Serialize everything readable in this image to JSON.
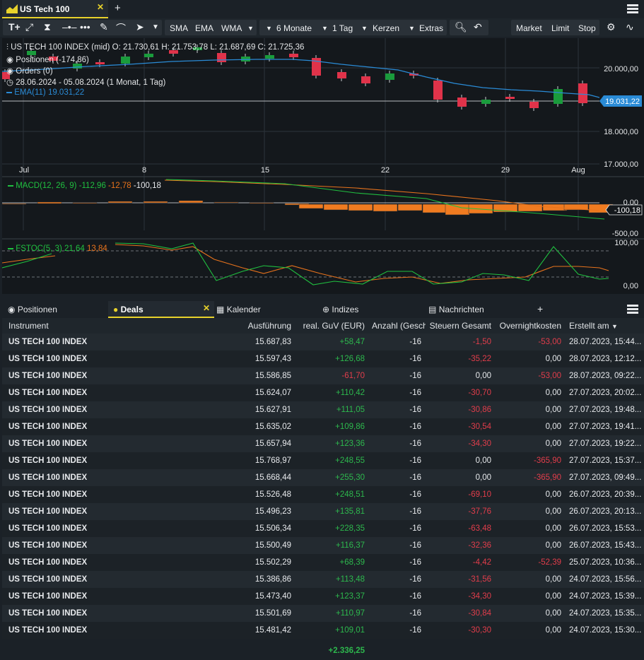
{
  "tab": {
    "title": "US Tech 100",
    "add": "+"
  },
  "toolbar": {
    "indicators": [
      "SMA",
      "EMA",
      "WMA"
    ],
    "period": "6 Monate",
    "interval": "1 Tag",
    "chart_type": "Kerzen",
    "extras": "Extras",
    "orders": [
      "Market",
      "Limit",
      "Stop"
    ]
  },
  "chart": {
    "info": {
      "line1": "US TECH 100 INDEX (mid)  O: 21.730,61  H: 21.753,78  L: 21.687,69  C: 21.725,36",
      "line2": "Positionen (-174,86)",
      "line3": "Orders (0)",
      "line4": "28.06.2024 - 05.08.2024  (1 Monat, 1 Tag)",
      "ema_label": "EMA(11)",
      "ema_value": "19.031,22"
    },
    "price_ticks": [
      "20.000,00",
      "18.000,00",
      "17.000,00"
    ],
    "current_price": "19.031,22",
    "x_labels": [
      "Jul",
      "8",
      "15",
      "22",
      "29",
      "Aug"
    ],
    "macd": {
      "label": "MACD(12, 26, 9)",
      "v1": "-112,96",
      "v2": "-12,78",
      "v3": "-100,18",
      "ticks": [
        "0,00",
        "-500,00"
      ],
      "current": "-100,18"
    },
    "fstoc": {
      "label": "FSTOC(5, 3)",
      "v1": "21,64",
      "v2": "13,84",
      "ticks": [
        "100,00",
        "0,00"
      ]
    },
    "colors": {
      "up": "#1a9b3c",
      "down": "#e0334a",
      "ema": "#2a8bd6",
      "macd_hist": "#f07b20",
      "signal_green": "#20c040"
    }
  },
  "bottom_tabs": [
    "Positionen",
    "Deals",
    "Kalender",
    "Indizes",
    "Nachrichten",
    "+"
  ],
  "table": {
    "headers": [
      "Instrument",
      "Ausführung",
      "real. GuV (EUR)",
      "Anzahl (Geschl",
      "Steuern Gesamt",
      "Overnightkosten",
      "Erstellt am"
    ],
    "rows": [
      {
        "instrument": "US TECH 100 INDEX",
        "exec": "15.687,83",
        "pnl": "+58,47",
        "qty": "-16",
        "tax": "-1,50",
        "overnight": "-53,00",
        "created": "28.07.2023, 15:44..."
      },
      {
        "instrument": "US TECH 100 INDEX",
        "exec": "15.597,43",
        "pnl": "+126,68",
        "qty": "-16",
        "tax": "-35,22",
        "overnight": "0,00",
        "created": "28.07.2023, 12:12..."
      },
      {
        "instrument": "US TECH 100 INDEX",
        "exec": "15.586,85",
        "pnl": "-61,70",
        "qty": "-16",
        "tax": "0,00",
        "overnight": "-53,00",
        "created": "28.07.2023, 09:22..."
      },
      {
        "instrument": "US TECH 100 INDEX",
        "exec": "15.624,07",
        "pnl": "+110,42",
        "qty": "-16",
        "tax": "-30,70",
        "overnight": "0,00",
        "created": "27.07.2023, 20:02..."
      },
      {
        "instrument": "US TECH 100 INDEX",
        "exec": "15.627,91",
        "pnl": "+111,05",
        "qty": "-16",
        "tax": "-30,86",
        "overnight": "0,00",
        "created": "27.07.2023, 19:48..."
      },
      {
        "instrument": "US TECH 100 INDEX",
        "exec": "15.635,02",
        "pnl": "+109,86",
        "qty": "-16",
        "tax": "-30,54",
        "overnight": "0,00",
        "created": "27.07.2023, 19:41..."
      },
      {
        "instrument": "US TECH 100 INDEX",
        "exec": "15.657,94",
        "pnl": "+123,36",
        "qty": "-16",
        "tax": "-34,30",
        "overnight": "0,00",
        "created": "27.07.2023, 19:22..."
      },
      {
        "instrument": "US TECH 100 INDEX",
        "exec": "15.768,97",
        "pnl": "+248,55",
        "qty": "-16",
        "tax": "0,00",
        "overnight": "-365,90",
        "created": "27.07.2023, 15:37..."
      },
      {
        "instrument": "US TECH 100 INDEX",
        "exec": "15.668,44",
        "pnl": "+255,30",
        "qty": "-16",
        "tax": "0,00",
        "overnight": "-365,90",
        "created": "27.07.2023, 09:49..."
      },
      {
        "instrument": "US TECH 100 INDEX",
        "exec": "15.526,48",
        "pnl": "+248,51",
        "qty": "-16",
        "tax": "-69,10",
        "overnight": "0,00",
        "created": "26.07.2023, 20:39..."
      },
      {
        "instrument": "US TECH 100 INDEX",
        "exec": "15.496,23",
        "pnl": "+135,81",
        "qty": "-16",
        "tax": "-37,76",
        "overnight": "0,00",
        "created": "26.07.2023, 20:13..."
      },
      {
        "instrument": "US TECH 100 INDEX",
        "exec": "15.506,34",
        "pnl": "+228,35",
        "qty": "-16",
        "tax": "-63,48",
        "overnight": "0,00",
        "created": "26.07.2023, 15:53..."
      },
      {
        "instrument": "US TECH 100 INDEX",
        "exec": "15.500,49",
        "pnl": "+116,37",
        "qty": "-16",
        "tax": "-32,36",
        "overnight": "0,00",
        "created": "26.07.2023, 15:43..."
      },
      {
        "instrument": "US TECH 100 INDEX",
        "exec": "15.502,29",
        "pnl": "+68,39",
        "qty": "-16",
        "tax": "-4,42",
        "overnight": "-52,39",
        "created": "25.07.2023, 10:36..."
      },
      {
        "instrument": "US TECH 100 INDEX",
        "exec": "15.386,86",
        "pnl": "+113,48",
        "qty": "-16",
        "tax": "-31,56",
        "overnight": "0,00",
        "created": "24.07.2023, 15:56..."
      },
      {
        "instrument": "US TECH 100 INDEX",
        "exec": "15.473,40",
        "pnl": "+123,37",
        "qty": "-16",
        "tax": "-34,30",
        "overnight": "0,00",
        "created": "24.07.2023, 15:39..."
      },
      {
        "instrument": "US TECH 100 INDEX",
        "exec": "15.501,69",
        "pnl": "+110,97",
        "qty": "-16",
        "tax": "-30,84",
        "overnight": "0,00",
        "created": "24.07.2023, 15:35..."
      },
      {
        "instrument": "US TECH 100 INDEX",
        "exec": "15.481,42",
        "pnl": "+109,01",
        "qty": "-16",
        "tax": "-30,30",
        "overnight": "0,00",
        "created": "24.07.2023, 15:30..."
      }
    ],
    "total": "+2.336,25"
  }
}
